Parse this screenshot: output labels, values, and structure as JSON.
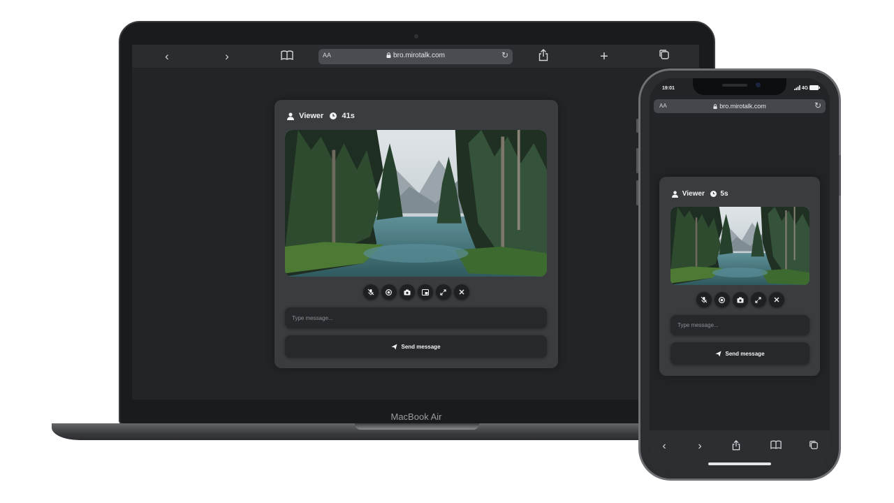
{
  "laptop": {
    "browser": {
      "back": "‹",
      "forward": "›",
      "text_size": "AA",
      "url": "bro.mirotalk.com",
      "plus": "+"
    },
    "card": {
      "role": "Viewer",
      "timer": "41s",
      "message_placeholder": "Type message...",
      "send_label": "Send message"
    },
    "brand": "MacBook Air"
  },
  "phone": {
    "status": {
      "time": "19:01",
      "network": "4G"
    },
    "browser": {
      "text_size": "AA",
      "url": "bro.mirotalk.com"
    },
    "card": {
      "role": "Viewer",
      "timer": "5s",
      "message_placeholder": "Type message...",
      "send_label": "Send message"
    },
    "bottom_bar": {
      "back": "‹",
      "forward": "›"
    }
  }
}
